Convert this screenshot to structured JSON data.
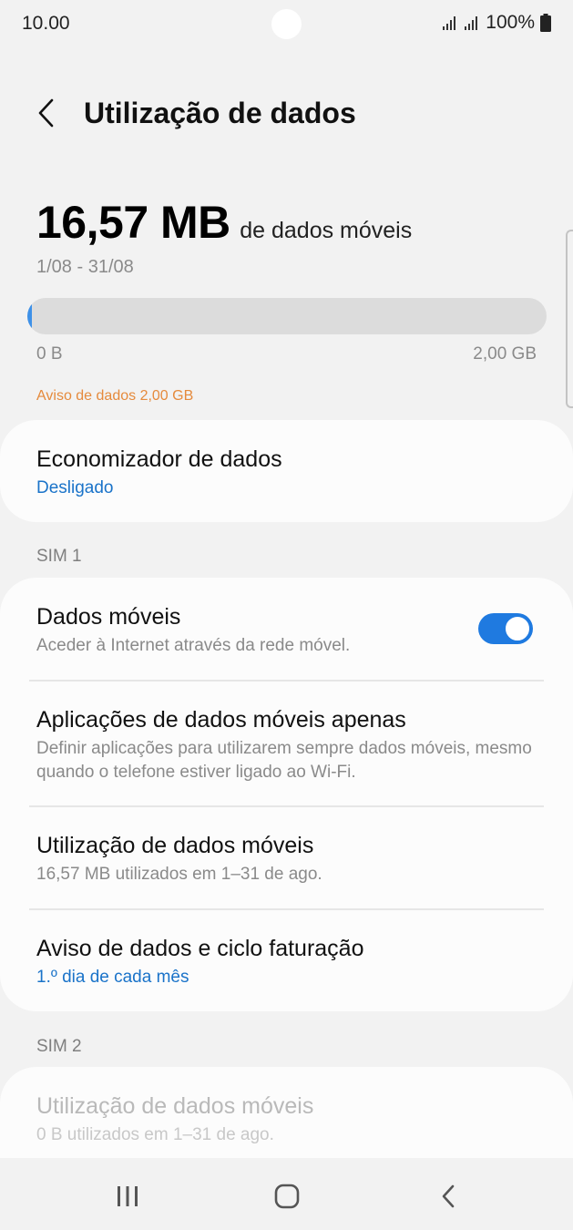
{
  "status": {
    "time": "10.00",
    "battery": "100%",
    "icons": [
      "signal-icon",
      "signal-icon",
      "battery-icon"
    ]
  },
  "header": {
    "title": "Utilização de dados",
    "back_icon": "chevron-left-icon"
  },
  "usage": {
    "amount": "16,57 MB",
    "suffix": "de dados móveis",
    "period": "1/08 - 31/08",
    "progress_fraction": 0.008,
    "min_label": "0 B",
    "max_label": "2,00 GB",
    "warning": "Aviso de dados 2,00 GB"
  },
  "data_saver": {
    "title": "Economizador de dados",
    "status": "Desligado"
  },
  "sim1": {
    "label": "SIM 1",
    "items": [
      {
        "title": "Dados móveis",
        "subtitle": "Aceder à Internet através da rede móvel.",
        "toggle": true
      },
      {
        "title": "Aplicações de dados móveis apenas",
        "subtitle": "Definir aplicações para utilizarem sempre dados móveis, mesmo quando o telefone estiver ligado ao Wi-Fi."
      },
      {
        "title": "Utilização de dados móveis",
        "subtitle": "16,57 MB utilizados em 1–31 de ago."
      },
      {
        "title": "Aviso de dados e ciclo faturação",
        "subtitle": "1.º dia de cada mês"
      }
    ]
  },
  "sim2": {
    "label": "SIM 2",
    "items": [
      {
        "title": "Utilização de dados móveis",
        "subtitle": "0 B utilizados em 1–31 de ago."
      }
    ]
  },
  "colors": {
    "accent": "#1f7ae0",
    "link": "#1a73c9",
    "warning": "#e58a3c",
    "background": "#f2f2f2",
    "card": "#fcfcfc"
  },
  "navbar": {
    "icons": [
      "recent-apps-icon",
      "home-icon",
      "back-icon"
    ]
  }
}
